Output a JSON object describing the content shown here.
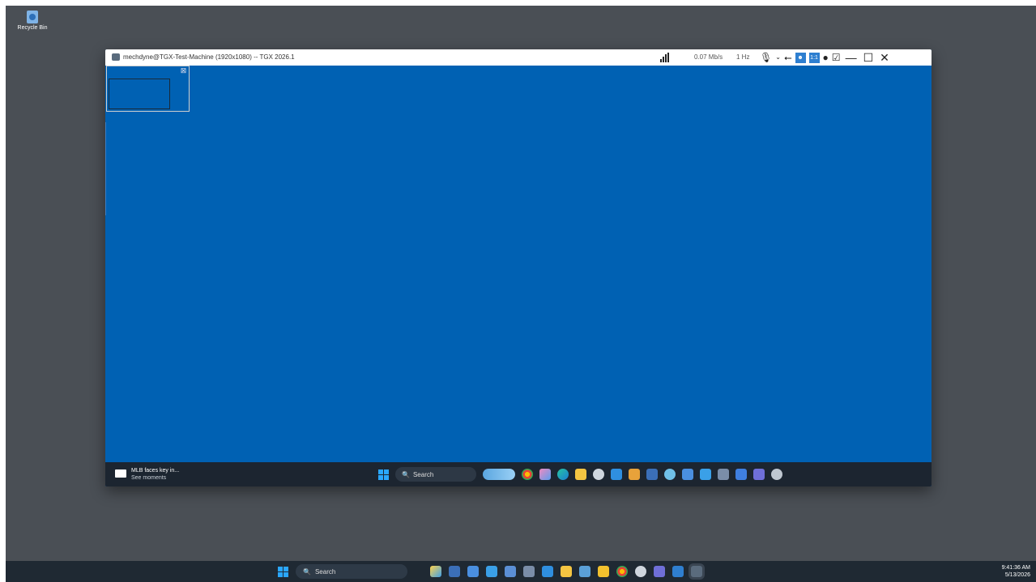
{
  "desktop": {
    "recycle_bin_label": "Recycle Bin"
  },
  "remote_window": {
    "title": "mechdyne@TGX-Test-Machine (1920x1080) -- TGX 2026.1",
    "bitrate": "0.07 Mb/s",
    "framerate": "1 Hz",
    "scale_label": "1:1",
    "toolbar_icons": [
      "signal-strength-icon",
      "microphone-icon",
      "chevron-down-icon",
      "usb-icon",
      "user-icon",
      "one-to-one-icon",
      "palette-icon",
      "fit-window-icon",
      "minimize-icon",
      "restore-icon",
      "close-icon"
    ],
    "inner_taskbar": {
      "news_headline": "MLB faces key in...",
      "news_sub": "See moments",
      "search_label": "Search",
      "icons": [
        "start-icon",
        "search-icon",
        "whale-widget-icon",
        "chrome-icon",
        "copilot-icon",
        "edge-icon",
        "file-explorer-icon",
        "settings-icon",
        "visual-studio-icon",
        "app-icon",
        "terminal-icon",
        "network-icon",
        "remote-desktop-icon",
        "photos-icon",
        "control-panel-icon",
        "notepad-icon",
        "teams-icon",
        "gear-icon"
      ]
    }
  },
  "host_taskbar": {
    "search_label": "Search",
    "time": "9:41:36 AM",
    "date": "5/13/2026",
    "icons": [
      "start-icon",
      "search-icon",
      "paint-icon",
      "terminal-icon",
      "remote-desktop-icon",
      "photos-icon",
      "remote-app-icon",
      "control-panel-icon",
      "visual-studio-icon",
      "file-explorer-icon",
      "monitor-icon",
      "sticky-notes-icon",
      "chrome-icon",
      "settings-icon",
      "teams-icon",
      "tgx-viewer-icon",
      "remote-session-icon"
    ]
  },
  "colors": {
    "remote_background": "#0061b3",
    "host_desktop": "#4a4f55",
    "taskbar": "#1f2933",
    "accent": "#2aa7ff"
  }
}
